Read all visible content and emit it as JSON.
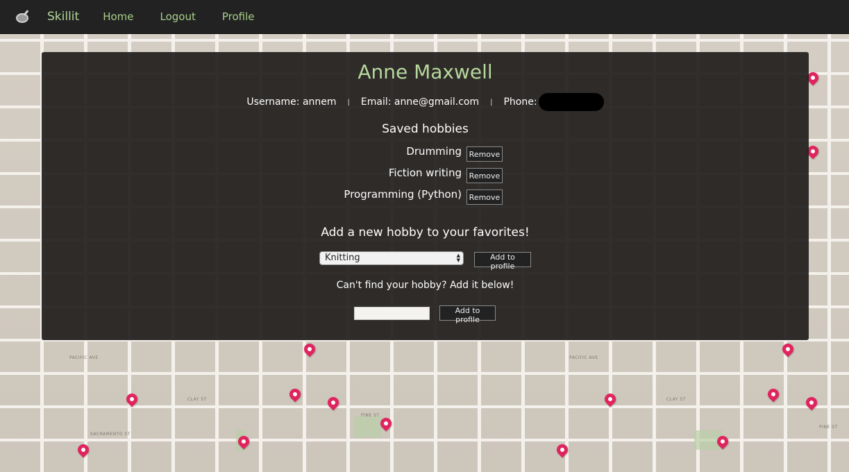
{
  "nav": {
    "brand": "Skillit",
    "links": [
      "Home",
      "Logout",
      "Profile"
    ]
  },
  "profile": {
    "name": "Anne Maxwell",
    "username_label": "Username: annem",
    "email_label": "Email: anne@gmail.com",
    "phone_label": "Phone:",
    "separator": "|"
  },
  "saved_hobbies": {
    "title": "Saved hobbies",
    "remove_label": "Remove",
    "items": [
      "Drumming",
      "Fiction writing",
      "Programming (Python)"
    ]
  },
  "add_hobby": {
    "title": "Add a new hobby to your favorites!",
    "selected": "Knitting",
    "button": "Add to profile",
    "cant_find": "Can't find your hobby? Add it below!",
    "custom_value": "",
    "button2": "Add to profile"
  },
  "colors": {
    "accent": "#b6d89b",
    "navbar": "#222222",
    "pin": "#e0245e"
  }
}
